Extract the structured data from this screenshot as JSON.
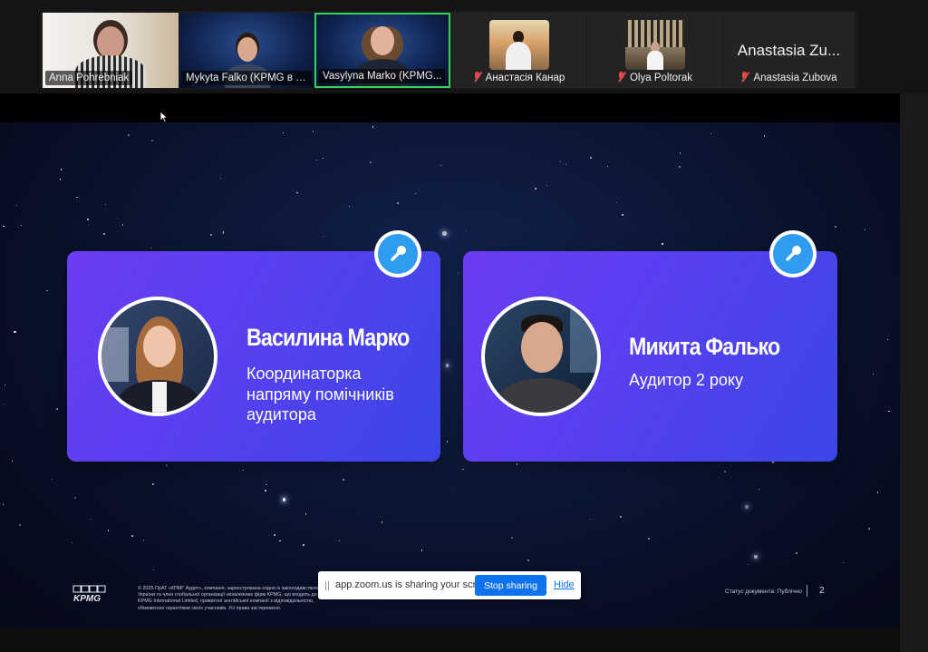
{
  "participants": [
    {
      "name": "Anna Pohrebniak",
      "muted": false,
      "type": "video"
    },
    {
      "name": "Mykyta Falko (KPMG в У...",
      "muted": false,
      "type": "video"
    },
    {
      "name": "Vasylyna Marko (KPMG...",
      "muted": false,
      "type": "video",
      "speaking": true
    },
    {
      "name": "Анастасія Канар",
      "muted": true,
      "type": "avatar"
    },
    {
      "name": "Olya Poltorak",
      "muted": true,
      "type": "avatar"
    },
    {
      "name": "Anastasia Zubova",
      "muted": true,
      "type": "name-only",
      "display_name": "Anastasia Zu..."
    }
  ],
  "slide": {
    "speakers": [
      {
        "name": "Василина Марко",
        "role": [
          "Координаторка",
          "напряму помічників",
          "аудитора"
        ]
      },
      {
        "name": "Микита Фалько",
        "role": [
          "Аудитор 2 року"
        ]
      }
    ],
    "footer": {
      "logo": "KPMG",
      "legal": "© 2025 ПрАТ «КПМГ Аудит», компанія, зареєстрована згідно із законодавством України та член глобальної організації незалежних фірм KPMG, що входять до KPMG International Limited, приватної англійської компанії з відповідальністю, обмеженою гарантіями своїх учасників. Усі права застережено.",
      "doc_status": "Статус документа: Публічно",
      "page_number": "2"
    }
  },
  "share_banner": {
    "text": "app.zoom.us is sharing your screen.",
    "stop_label": "Stop sharing",
    "hide_label": "Hide"
  },
  "colors": {
    "speaking_border": "#36d45a",
    "muted_icon": "#e04a4a",
    "card_gradient_start": "#6b3cf2",
    "card_gradient_end": "#3b46e6",
    "mic_badge": "#2f9cf0",
    "stop_button": "#0e72ed"
  }
}
